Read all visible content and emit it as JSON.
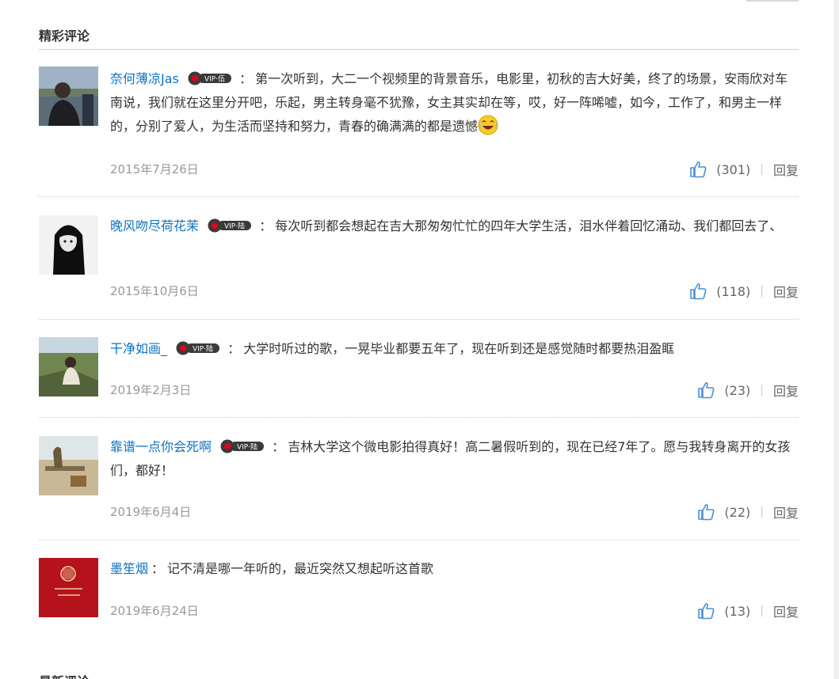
{
  "section_title": "精彩评论",
  "comments": [
    {
      "user": "奈何薄凉Jas",
      "vip_text": "VIP·伍",
      "text": "第一次听到，大二一个视频里的背景音乐，电影里，初秋的吉大好美，终了的场景，安雨欣对车南说，我们就在这里分开吧，乐起，男主转身毫不犹豫，女主其实却在等，哎，好一阵唏嘘，如今，工作了，和男主一样的，分别了爱人，为生活而坚持和努力，青春的确满满的都是遗憾",
      "emoji": "laughing-tears-icon",
      "date": "2015年7月26日",
      "likes": "(301)",
      "reply": "回复"
    },
    {
      "user": "晚风吻尽荷花茉",
      "vip_text": "VIP·陆",
      "text": "每次听到都会想起在吉大那匆匆忙忙的四年大学生活，泪水伴着回忆涌动、我们都回去了、",
      "date": "2015年10月6日",
      "likes": "(118)",
      "reply": "回复"
    },
    {
      "user": "干净如画_",
      "vip_text": "VIP·陆",
      "text": "大学时听过的歌，一晃毕业都要五年了，现在听到还是感觉随时都要热泪盈眶",
      "date": "2019年2月3日",
      "likes": "(23)",
      "reply": "回复"
    },
    {
      "user": "靠谱一点你会死啊",
      "vip_text": "VIP·陆",
      "text": "吉林大学这个微电影拍得真好！高二暑假听到的，现在已经7年了。愿与我转身离开的女孩们，都好！",
      "date": "2019年6月4日",
      "likes": "(22)",
      "reply": "回复"
    },
    {
      "user": "墨笙烟",
      "text": "记不清是哪一年听的，最近突然又想起听这首歌",
      "date": "2019年6月24日",
      "likes": "(13)",
      "reply": "回复"
    }
  ],
  "next_section_partial": "最新评论",
  "colors": {
    "link": "#0c73c2",
    "like_icon": "#4a8fd4",
    "meta": "#999999"
  }
}
